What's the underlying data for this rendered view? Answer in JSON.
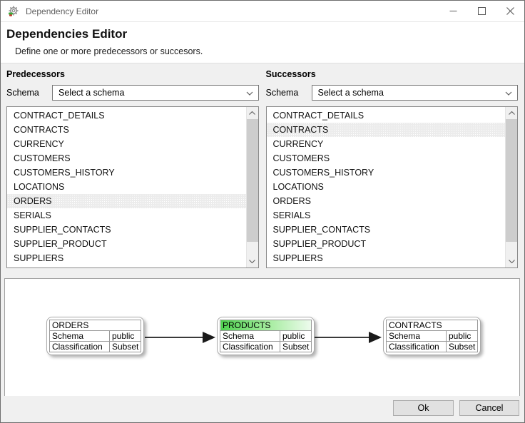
{
  "window": {
    "title": "Dependency Editor"
  },
  "header": {
    "title": "Dependencies Editor",
    "subtitle": "Define one or more predecessors or succesors."
  },
  "predecessors": {
    "section_title": "Predecessors",
    "schema_label": "Schema",
    "schema_value": "Select a schema",
    "items": [
      "CONTRACT_DETAILS",
      "CONTRACTS",
      "CURRENCY",
      "CUSTOMERS",
      "CUSTOMERS_HISTORY",
      "LOCATIONS",
      "ORDERS",
      "SERIALS",
      "SUPPLIER_CONTACTS",
      "SUPPLIER_PRODUCT",
      "SUPPLIERS"
    ],
    "selected_item": "ORDERS"
  },
  "successors": {
    "section_title": "Successors",
    "schema_label": "Schema",
    "schema_value": "Select a schema",
    "items": [
      "CONTRACT_DETAILS",
      "CONTRACTS",
      "CURRENCY",
      "CUSTOMERS",
      "CUSTOMERS_HISTORY",
      "LOCATIONS",
      "ORDERS",
      "SERIALS",
      "SUPPLIER_CONTACTS",
      "SUPPLIER_PRODUCT",
      "SUPPLIERS"
    ],
    "selected_item": "CONTRACTS"
  },
  "diagram": {
    "nodes": [
      {
        "title": "ORDERS",
        "rows": [
          {
            "label": "Schema",
            "value": "public"
          },
          {
            "label": "Classification",
            "value": "Subset"
          }
        ],
        "highlighted": false
      },
      {
        "title": "PRODUCTS",
        "rows": [
          {
            "label": "Schema",
            "value": "public"
          },
          {
            "label": "Classification",
            "value": "Subset"
          }
        ],
        "highlighted": true
      },
      {
        "title": "CONTRACTS",
        "rows": [
          {
            "label": "Schema",
            "value": "public"
          },
          {
            "label": "Classification",
            "value": "Subset"
          }
        ],
        "highlighted": false
      }
    ],
    "edges": [
      {
        "from": "ORDERS",
        "to": "PRODUCTS"
      },
      {
        "from": "PRODUCTS",
        "to": "CONTRACTS"
      }
    ]
  },
  "footer": {
    "ok_label": "Ok",
    "cancel_label": "Cancel"
  },
  "colors": {
    "highlight_green_start": "#4fd24f",
    "highlight_green_end": "#eefbee",
    "selection_bg": "#ececec",
    "titlebar_bg": "#ffffff",
    "body_bg": "#f0f0f0"
  }
}
